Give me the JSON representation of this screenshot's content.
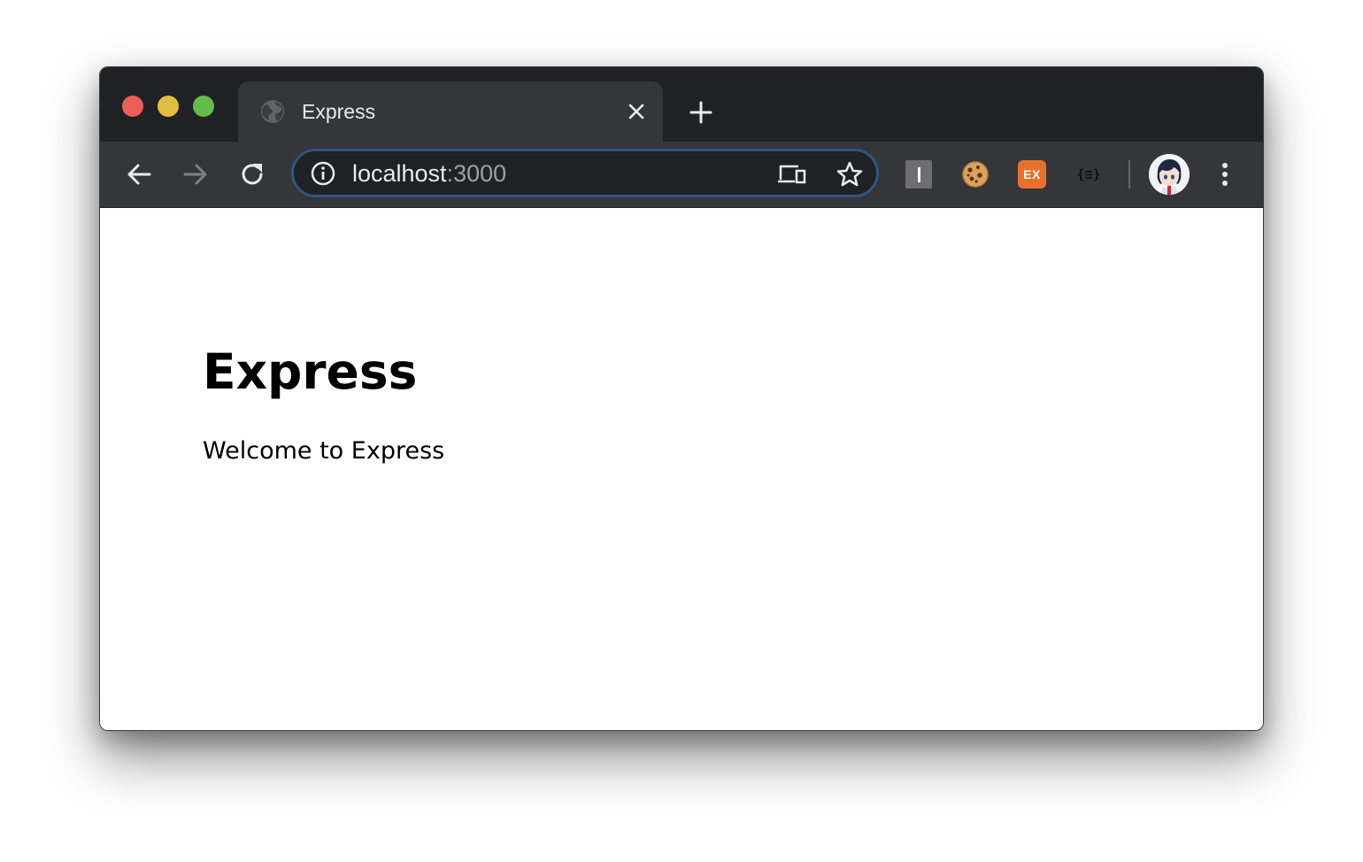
{
  "window": {
    "controls": [
      "close",
      "minimize",
      "zoom"
    ]
  },
  "tabs": [
    {
      "title": "Express",
      "favicon": "globe-icon",
      "active": true
    }
  ],
  "toolbar": {
    "back_icon": "back-arrow-icon",
    "forward_icon": "forward-arrow-icon",
    "reload_icon": "reload-icon",
    "omnibox": {
      "host": "localhost",
      "port": ":3000",
      "info_icon": "info-icon",
      "device_icon": "send-to-devices-icon",
      "bookmark_icon": "star-icon"
    },
    "extensions": [
      {
        "name": "i-extension",
        "label": "I"
      },
      {
        "name": "cookie-extension",
        "label": ""
      },
      {
        "name": "ex-extension",
        "label": "EX"
      },
      {
        "name": "json-viewer-extension",
        "label": "{≡}"
      }
    ],
    "menu_icon": "more-vert-icon"
  },
  "page": {
    "heading": "Express",
    "body": "Welcome to Express"
  },
  "colors": {
    "tabstrip": "#202124",
    "toolbar": "#35363a",
    "omnibox_border": "#2c5782",
    "close_light": "#ec5f57",
    "minimize_light": "#e3bd41",
    "zoom_light": "#63bc49",
    "ex_extension": "#e8702a"
  }
}
